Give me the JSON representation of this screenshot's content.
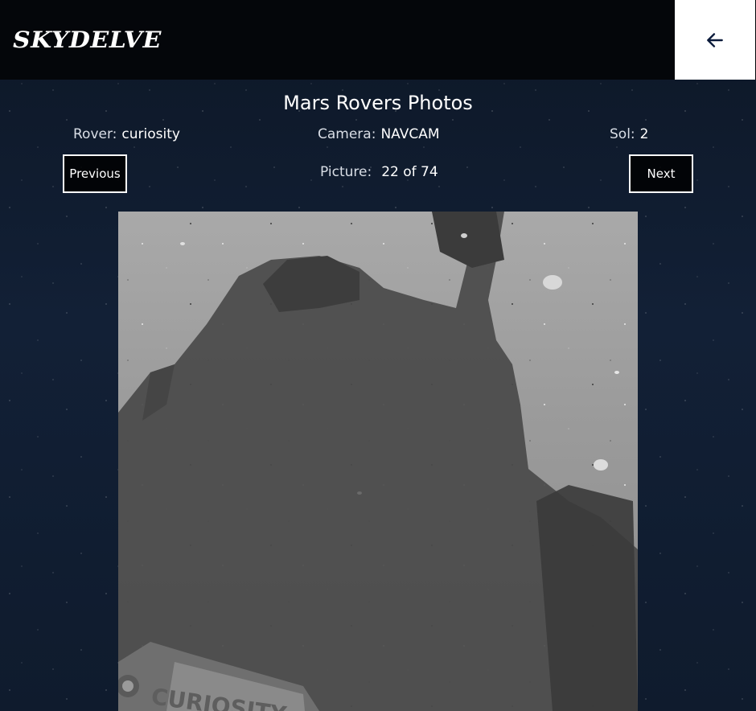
{
  "header": {
    "logo_text": "SKYDELVE",
    "back_icon": "arrow-left-icon"
  },
  "page": {
    "title": "Mars Rovers Photos"
  },
  "meta": {
    "rover_label": "Rover:",
    "rover_value": "curiosity",
    "camera_label": "Camera:",
    "camera_value": "NAVCAM",
    "sol_label": "Sol:",
    "sol_value": "2",
    "picture_label": "Picture:",
    "picture_value": "22 of 74"
  },
  "nav": {
    "previous_label": "Previous",
    "next_label": "Next"
  },
  "photo": {
    "plate_text": "CURIOSITY"
  }
}
